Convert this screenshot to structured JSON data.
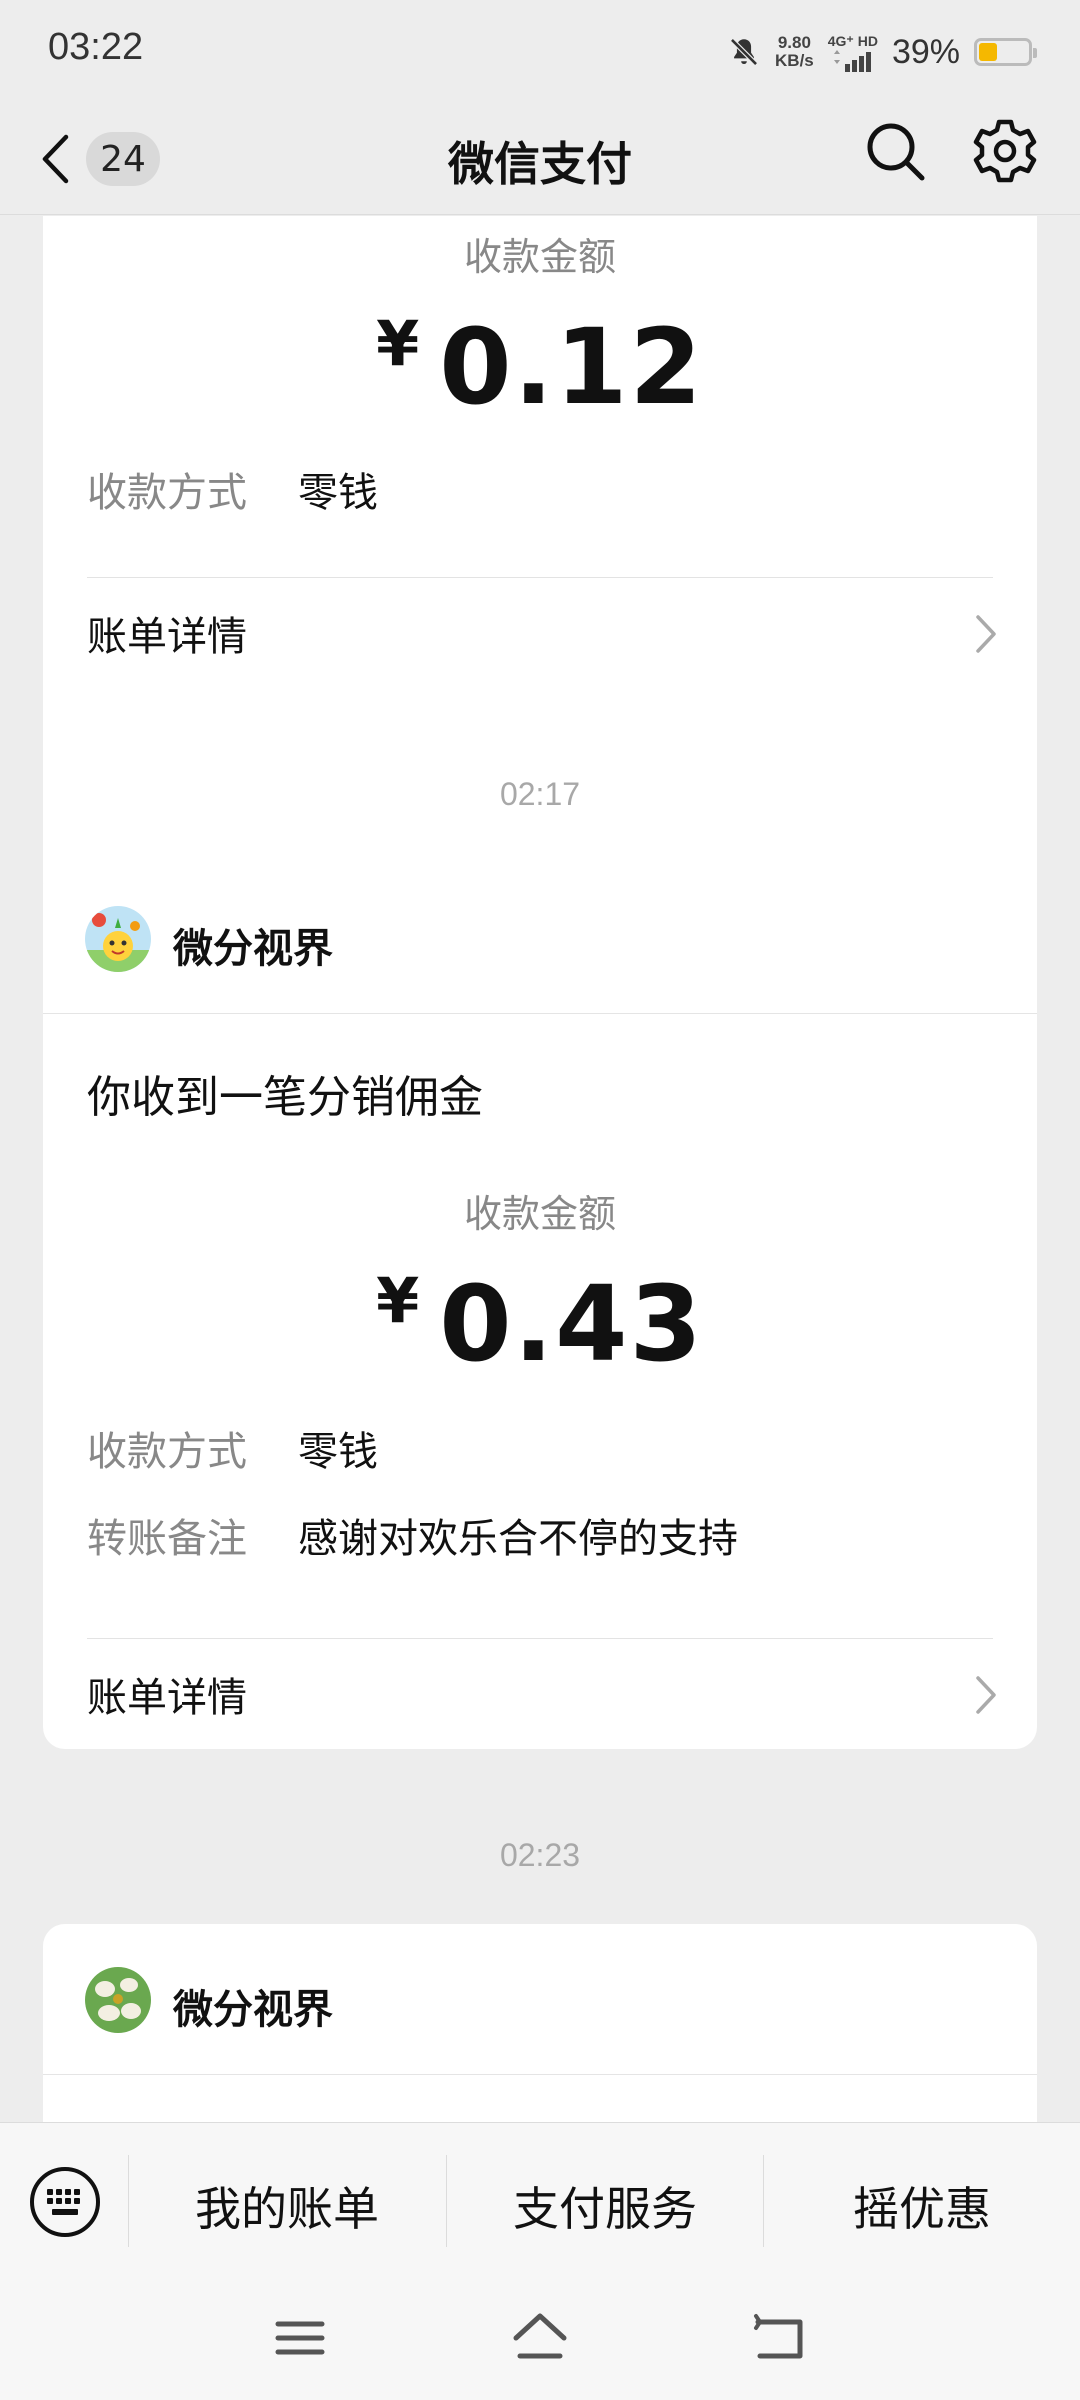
{
  "status_bar": {
    "time": "03:22",
    "net_speed_value": "9.80",
    "net_speed_unit": "KB/s",
    "net_type": "4G⁺ HD",
    "battery_percent": "39%",
    "battery_level": 0.39,
    "battery_color": "#f5b800"
  },
  "nav": {
    "unread_count": "24",
    "title": "微信支付",
    "search_icon": "search-icon",
    "settings_icon": "gear-icon"
  },
  "messages": [
    {
      "amount_label": "收款金额",
      "currency": "¥",
      "amount": "0.12",
      "method_label": "收款方式",
      "method_value": "零钱",
      "detail_label": "账单详情"
    },
    {
      "time": "02:17",
      "merchant": "微分视界",
      "headline": "你收到一笔分销佣金",
      "amount_label": "收款金额",
      "currency": "¥",
      "amount": "0.43",
      "method_label": "收款方式",
      "method_value": "零钱",
      "note_label": "转账备注",
      "note_value": "感谢对欢乐合不停的支持",
      "detail_label": "账单详情"
    },
    {
      "time": "02:23",
      "merchant": "微分视界"
    }
  ],
  "bottom_menu": {
    "items": [
      "我的账单",
      "支付服务",
      "摇优惠"
    ]
  }
}
